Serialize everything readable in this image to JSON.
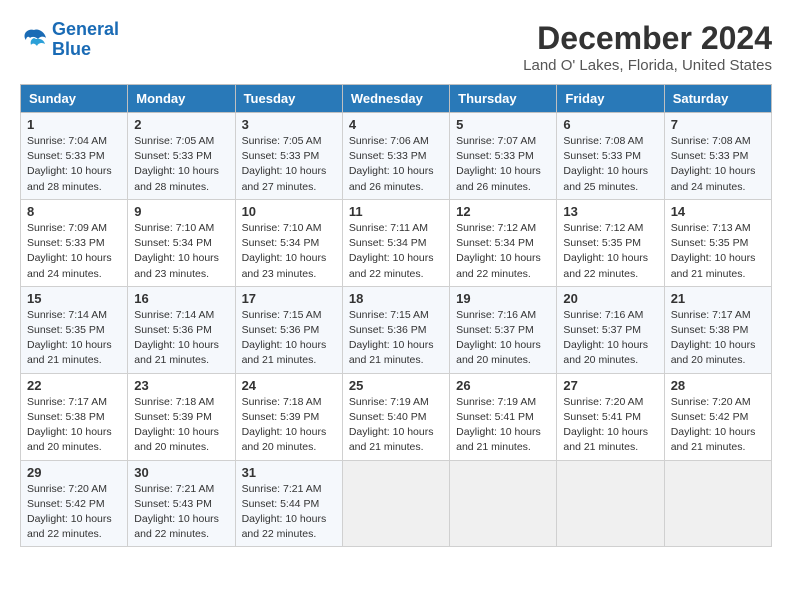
{
  "logo": {
    "line1": "General",
    "line2": "Blue"
  },
  "title": "December 2024",
  "location": "Land O' Lakes, Florida, United States",
  "days_of_week": [
    "Sunday",
    "Monday",
    "Tuesday",
    "Wednesday",
    "Thursday",
    "Friday",
    "Saturday"
  ],
  "weeks": [
    [
      {
        "day": "1",
        "sunrise": "Sunrise: 7:04 AM",
        "sunset": "Sunset: 5:33 PM",
        "daylight": "Daylight: 10 hours and 28 minutes."
      },
      {
        "day": "2",
        "sunrise": "Sunrise: 7:05 AM",
        "sunset": "Sunset: 5:33 PM",
        "daylight": "Daylight: 10 hours and 28 minutes."
      },
      {
        "day": "3",
        "sunrise": "Sunrise: 7:05 AM",
        "sunset": "Sunset: 5:33 PM",
        "daylight": "Daylight: 10 hours and 27 minutes."
      },
      {
        "day": "4",
        "sunrise": "Sunrise: 7:06 AM",
        "sunset": "Sunset: 5:33 PM",
        "daylight": "Daylight: 10 hours and 26 minutes."
      },
      {
        "day": "5",
        "sunrise": "Sunrise: 7:07 AM",
        "sunset": "Sunset: 5:33 PM",
        "daylight": "Daylight: 10 hours and 26 minutes."
      },
      {
        "day": "6",
        "sunrise": "Sunrise: 7:08 AM",
        "sunset": "Sunset: 5:33 PM",
        "daylight": "Daylight: 10 hours and 25 minutes."
      },
      {
        "day": "7",
        "sunrise": "Sunrise: 7:08 AM",
        "sunset": "Sunset: 5:33 PM",
        "daylight": "Daylight: 10 hours and 24 minutes."
      }
    ],
    [
      {
        "day": "8",
        "sunrise": "Sunrise: 7:09 AM",
        "sunset": "Sunset: 5:33 PM",
        "daylight": "Daylight: 10 hours and 24 minutes."
      },
      {
        "day": "9",
        "sunrise": "Sunrise: 7:10 AM",
        "sunset": "Sunset: 5:34 PM",
        "daylight": "Daylight: 10 hours and 23 minutes."
      },
      {
        "day": "10",
        "sunrise": "Sunrise: 7:10 AM",
        "sunset": "Sunset: 5:34 PM",
        "daylight": "Daylight: 10 hours and 23 minutes."
      },
      {
        "day": "11",
        "sunrise": "Sunrise: 7:11 AM",
        "sunset": "Sunset: 5:34 PM",
        "daylight": "Daylight: 10 hours and 22 minutes."
      },
      {
        "day": "12",
        "sunrise": "Sunrise: 7:12 AM",
        "sunset": "Sunset: 5:34 PM",
        "daylight": "Daylight: 10 hours and 22 minutes."
      },
      {
        "day": "13",
        "sunrise": "Sunrise: 7:12 AM",
        "sunset": "Sunset: 5:35 PM",
        "daylight": "Daylight: 10 hours and 22 minutes."
      },
      {
        "day": "14",
        "sunrise": "Sunrise: 7:13 AM",
        "sunset": "Sunset: 5:35 PM",
        "daylight": "Daylight: 10 hours and 21 minutes."
      }
    ],
    [
      {
        "day": "15",
        "sunrise": "Sunrise: 7:14 AM",
        "sunset": "Sunset: 5:35 PM",
        "daylight": "Daylight: 10 hours and 21 minutes."
      },
      {
        "day": "16",
        "sunrise": "Sunrise: 7:14 AM",
        "sunset": "Sunset: 5:36 PM",
        "daylight": "Daylight: 10 hours and 21 minutes."
      },
      {
        "day": "17",
        "sunrise": "Sunrise: 7:15 AM",
        "sunset": "Sunset: 5:36 PM",
        "daylight": "Daylight: 10 hours and 21 minutes."
      },
      {
        "day": "18",
        "sunrise": "Sunrise: 7:15 AM",
        "sunset": "Sunset: 5:36 PM",
        "daylight": "Daylight: 10 hours and 21 minutes."
      },
      {
        "day": "19",
        "sunrise": "Sunrise: 7:16 AM",
        "sunset": "Sunset: 5:37 PM",
        "daylight": "Daylight: 10 hours and 20 minutes."
      },
      {
        "day": "20",
        "sunrise": "Sunrise: 7:16 AM",
        "sunset": "Sunset: 5:37 PM",
        "daylight": "Daylight: 10 hours and 20 minutes."
      },
      {
        "day": "21",
        "sunrise": "Sunrise: 7:17 AM",
        "sunset": "Sunset: 5:38 PM",
        "daylight": "Daylight: 10 hours and 20 minutes."
      }
    ],
    [
      {
        "day": "22",
        "sunrise": "Sunrise: 7:17 AM",
        "sunset": "Sunset: 5:38 PM",
        "daylight": "Daylight: 10 hours and 20 minutes."
      },
      {
        "day": "23",
        "sunrise": "Sunrise: 7:18 AM",
        "sunset": "Sunset: 5:39 PM",
        "daylight": "Daylight: 10 hours and 20 minutes."
      },
      {
        "day": "24",
        "sunrise": "Sunrise: 7:18 AM",
        "sunset": "Sunset: 5:39 PM",
        "daylight": "Daylight: 10 hours and 20 minutes."
      },
      {
        "day": "25",
        "sunrise": "Sunrise: 7:19 AM",
        "sunset": "Sunset: 5:40 PM",
        "daylight": "Daylight: 10 hours and 21 minutes."
      },
      {
        "day": "26",
        "sunrise": "Sunrise: 7:19 AM",
        "sunset": "Sunset: 5:41 PM",
        "daylight": "Daylight: 10 hours and 21 minutes."
      },
      {
        "day": "27",
        "sunrise": "Sunrise: 7:20 AM",
        "sunset": "Sunset: 5:41 PM",
        "daylight": "Daylight: 10 hours and 21 minutes."
      },
      {
        "day": "28",
        "sunrise": "Sunrise: 7:20 AM",
        "sunset": "Sunset: 5:42 PM",
        "daylight": "Daylight: 10 hours and 21 minutes."
      }
    ],
    [
      {
        "day": "29",
        "sunrise": "Sunrise: 7:20 AM",
        "sunset": "Sunset: 5:42 PM",
        "daylight": "Daylight: 10 hours and 22 minutes."
      },
      {
        "day": "30",
        "sunrise": "Sunrise: 7:21 AM",
        "sunset": "Sunset: 5:43 PM",
        "daylight": "Daylight: 10 hours and 22 minutes."
      },
      {
        "day": "31",
        "sunrise": "Sunrise: 7:21 AM",
        "sunset": "Sunset: 5:44 PM",
        "daylight": "Daylight: 10 hours and 22 minutes."
      },
      null,
      null,
      null,
      null
    ]
  ]
}
